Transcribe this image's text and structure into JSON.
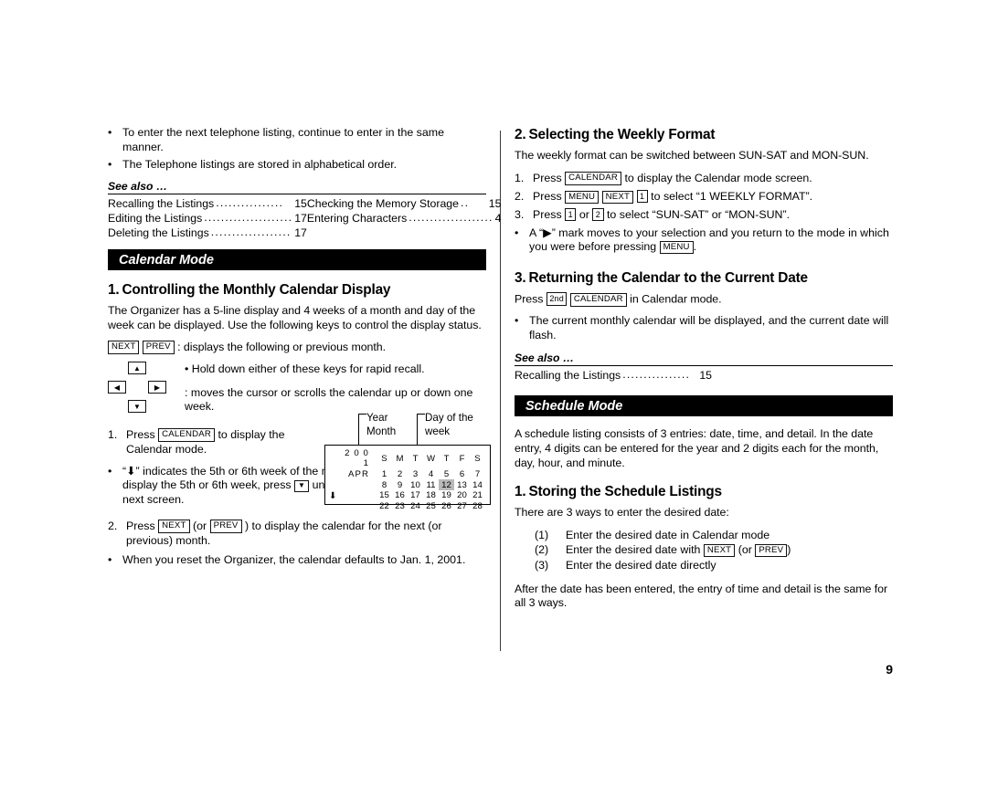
{
  "page_number": "9",
  "left_column": {
    "top_bullets": [
      "To enter the next telephone listing, continue to enter in the same manner.",
      "The Telephone listings are stored in alphabetical order."
    ],
    "see_also": {
      "title": "See also …",
      "left_entries": [
        {
          "name": "Recalling the Listings",
          "dots": "................",
          "page": "15"
        },
        {
          "name": "Editing the Listings",
          "dots": ".....................",
          "page": "17"
        },
        {
          "name": "Deleting the Listings",
          "dots": "...................",
          "page": "17"
        }
      ],
      "right_entries": [
        {
          "name": "Checking the Memory Storage",
          "dots": "..",
          "page": "15"
        },
        {
          "name": "Entering Characters",
          "dots": "....................",
          "page": "4"
        }
      ]
    },
    "mode_banner": "Calendar Mode",
    "section1": {
      "number": "1.",
      "title": "Controlling the Monthly Calendar Display",
      "intro": "The Organizer has a 5-line display and 4 weeks of a month and day of the week can be displayed. Use the following keys to control the display status.",
      "keys_line": {
        "key_next": "NEXT",
        "key_prev": "PREV",
        "text": ": displays the following or previous month."
      },
      "dpad": {
        "up": "▲",
        "down": "▼",
        "left": "◀",
        "right": "▶",
        "note": "• Hold down either of these keys for rapid recall.",
        "desc": ": moves the cursor or scrolls the calendar up or down one week."
      },
      "step1": {
        "num": "1.",
        "pre": "Press",
        "key_calendar": "CALENDAR",
        "post": "to display the",
        "line2": "Calendar mode."
      },
      "bullet_scroll": {
        "p1": "“",
        "glyph": "⬇",
        "p2": "” indicates the 5th or 6th week of the month is hidden below. To display the 5th or 6th week, press",
        "key_down": "▼",
        "p3": "until the cursor scrolls into the next screen."
      },
      "step2": {
        "num": "2.",
        "pre": "Press",
        "key_next": "NEXT",
        "mid": "(or",
        "key_prev": "PREV",
        "post": ") to display the calendar for the next (or previous) month."
      },
      "bullet_reset": "When you reset the Organizer, the calendar defaults to Jan. 1, 2001."
    },
    "lcd_figure": {
      "callout_year": "Year",
      "callout_month": "Month",
      "callout_dow": "Day of the",
      "callout_week": "week",
      "scroll_arrow": "⬇",
      "year": "2 0 0 1",
      "month": "APR",
      "weekday_headers": [
        "S",
        "M",
        "T",
        "W",
        "T",
        "F",
        "S"
      ],
      "weeks": [
        [
          "1",
          "2",
          "3",
          "4",
          "5",
          "6",
          "7"
        ],
        [
          "8",
          "9",
          "10",
          "11",
          "12",
          "13",
          "14"
        ],
        [
          "15",
          "16",
          "17",
          "18",
          "19",
          "20",
          "21"
        ],
        [
          "22",
          "23",
          "24",
          "25",
          "26",
          "27",
          "28"
        ]
      ],
      "highlighted": "12"
    }
  },
  "right_column": {
    "section2": {
      "number": "2.",
      "title": "Selecting the Weekly Format",
      "intro": "The weekly format can be switched between SUN-SAT and MON-SUN.",
      "step1": {
        "num": "1.",
        "pre": "Press",
        "key_calendar": "CALENDAR",
        "post": "to display the Calendar mode screen."
      },
      "step2": {
        "num": "2.",
        "pre": "Press",
        "key_menu": "MENU",
        "key_next": "NEXT",
        "key_1": "1",
        "post": "to select “1 WEEKLY FORMAT”."
      },
      "step3": {
        "num": "3.",
        "pre": "Press",
        "key_1": "1",
        "mid": "or",
        "key_2": "2",
        "post": "to select “SUN-SAT” or “MON-SUN”."
      },
      "bullet": {
        "p1": "A “",
        "glyph": "▶",
        "p2": "” mark moves to your selection and you return to the mode in which you were before pressing",
        "key_menu": "MENU",
        "p3": "."
      }
    },
    "section3": {
      "number": "3.",
      "title": "Returning the Calendar to the Current Date",
      "line": {
        "pre": "Press",
        "key_2nd": "2nd",
        "key_calendar": "CALENDAR",
        "post": "in Calendar mode."
      },
      "bullet": "The current monthly calendar will be displayed, and the current date will flash.",
      "see_also": {
        "title": "See also …",
        "entries": [
          {
            "name": "Recalling the Listings",
            "dots": "................",
            "page": "15"
          }
        ]
      }
    },
    "mode_banner": "Schedule Mode",
    "schedule_intro": "A schedule listing consists of 3 entries: date, time, and detail. In the date entry, 4 digits can be entered for the year and 2 digits each for the month, day, hour, and minute.",
    "section4": {
      "number": "1.",
      "title": "Storing the Schedule Listings",
      "intro": "There are 3 ways to enter the desired date:",
      "items": [
        {
          "marker": "(1)",
          "pre": "Enter the desired date in Calendar mode",
          "key_a": "",
          "mid": "",
          "key_b": "",
          "post": ""
        },
        {
          "marker": "(2)",
          "pre": "Enter the desired date with",
          "key_a": "NEXT",
          "mid": "(or",
          "key_b": "PREV",
          "post": ")"
        },
        {
          "marker": "(3)",
          "pre": "Enter the desired date directly",
          "key_a": "",
          "mid": "",
          "key_b": "",
          "post": ""
        }
      ],
      "outro": "After the date has been entered, the entry of time and detail is the same for all 3 ways."
    }
  }
}
